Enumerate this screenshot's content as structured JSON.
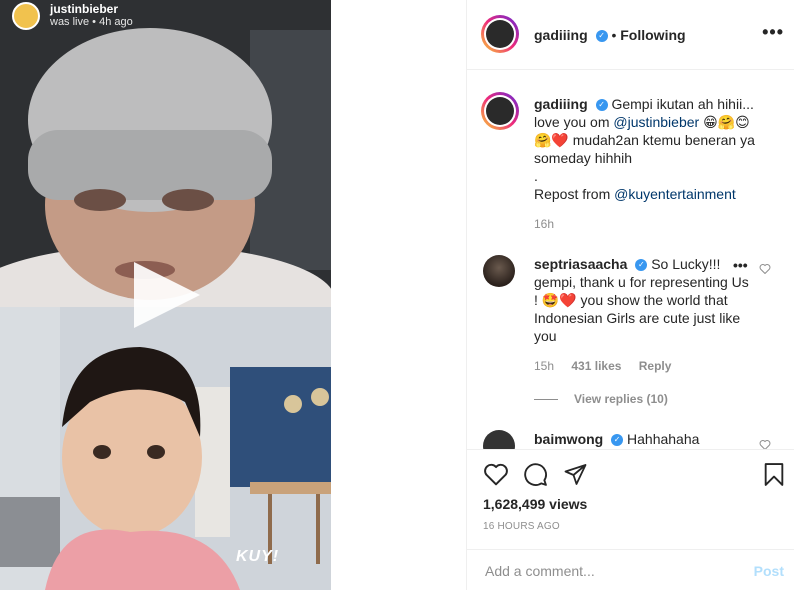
{
  "media": {
    "live_username": "justinbieber",
    "live_status": "was live • 4h ago",
    "watermark": "KUY!"
  },
  "post": {
    "author": "gadiiing",
    "follow_status": "Following",
    "more_label": "•••",
    "caption": {
      "author": "gadiiing",
      "text_1": "Gempi ikutan ah hihii... love you om ",
      "mention_1": "@justinbieber",
      "emoji_1": " 😁🤗😊",
      "text_2": "🤗❤️ mudah2an ktemu beneran ya someday hihhih",
      "dot": ".",
      "repost_text": "Repost from ",
      "mention_2": "@kuyentertainment",
      "time": "16h"
    },
    "comments": [
      {
        "username": "septriasaacha",
        "text": "So Lucky!!! gempi, thank u for representing Us ! 🤩❤️ you show the world that Indonesian Girls are cute just like you",
        "time": "15h",
        "likes": "431 likes",
        "reply_label": "Reply",
        "view_replies": "View replies (10)"
      },
      {
        "username": "baimwong",
        "text": "Hahhahaha"
      }
    ],
    "views": "1,628,499 views",
    "timestamp": "16 HOURS AGO",
    "add_comment_placeholder": "Add a comment...",
    "post_label": "Post"
  },
  "icons": {
    "like": "heart-icon",
    "comment": "comment-icon",
    "share": "share-icon",
    "save": "bookmark-icon",
    "play": "play-icon",
    "verified": "verified-badge-icon"
  },
  "colors": {
    "accent": "#0095f6",
    "link": "#00376b",
    "muted": "#8e8e8e",
    "verified": "#3897f0"
  }
}
